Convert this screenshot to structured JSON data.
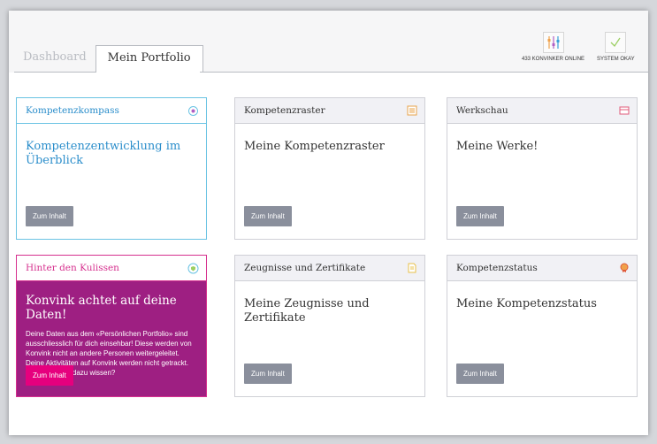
{
  "tabs": [
    {
      "label": "Dashboard",
      "active": false
    },
    {
      "label": "Mein Portfolio",
      "active": true
    }
  ],
  "status": {
    "online": {
      "label": "433 KONVINKER ONLINE",
      "icon": "sliders-icon"
    },
    "system": {
      "label": "SYSTEM OKAY",
      "icon": "checkmark-icon"
    }
  },
  "cards": [
    {
      "title": "Kompetenzkompass",
      "icon": "compass-icon",
      "body": "Kompetenzentwicklung im Überblick",
      "button": "Zum Inhalt",
      "accent": "#2b8ecb"
    },
    {
      "title": "Kompetenzraster",
      "icon": "grid-icon",
      "body": "Meine Kompetenzraster",
      "button": "Zum Inhalt",
      "accent": "#e8a34a"
    },
    {
      "title": "Werkschau",
      "icon": "card-icon",
      "body": "Meine Werke!",
      "button": "Zum Inhalt",
      "accent": "#e05a7a"
    },
    {
      "title": "Hinter den Kulissen",
      "icon": "shield-icon",
      "body": "Konvink achtet auf deine Daten!",
      "description": "Deine Daten aus dem «Persönlichen Portfolio» sind ausschliesslich für dich einsehbar! Diese werden von Konvink nicht an andere Personen weitergeleitet. Deine Aktivitäten auf Konvink werden nicht getrackt. Willst du mehr dazu wissen?",
      "button": "Zum Inhalt",
      "accent": "#d6308e"
    },
    {
      "title": "Zeugnisse und Zertifikate",
      "icon": "document-icon",
      "body": "Meine Zeugnisse und Zertifikate",
      "button": "Zum Inhalt",
      "accent": "#e8c14a"
    },
    {
      "title": "Kompetenzstatus",
      "icon": "badge-icon",
      "body": "Meine Kompetenzstatus",
      "button": "Zum Inhalt",
      "accent": "#e05a3a"
    }
  ]
}
